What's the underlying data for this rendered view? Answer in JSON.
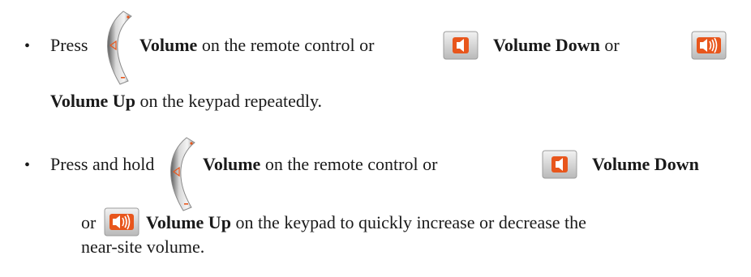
{
  "bullets": [
    {
      "press": "Press",
      "volume": "Volume",
      "remote_text": "on the remote control or",
      "volume_down": "Volume Down",
      "or": "or",
      "volume_up": "Volume Up",
      "tail": "on the keypad repeatedly."
    },
    {
      "press": "Press and hold",
      "volume": "Volume",
      "remote_text": "on the remote control or",
      "volume_down": "Volume Down",
      "or": "or",
      "volume_up": "Volume Up",
      "tail": "on the keypad to quickly increase or decrease the",
      "tail2": "near-site volume."
    }
  ],
  "icons": {
    "rocker": "volume-rocker-icon",
    "down": "volume-down-icon",
    "up": "volume-up-icon"
  },
  "colors": {
    "icon_orange": "#e8561c",
    "icon_bg": "#d9d9d9"
  }
}
